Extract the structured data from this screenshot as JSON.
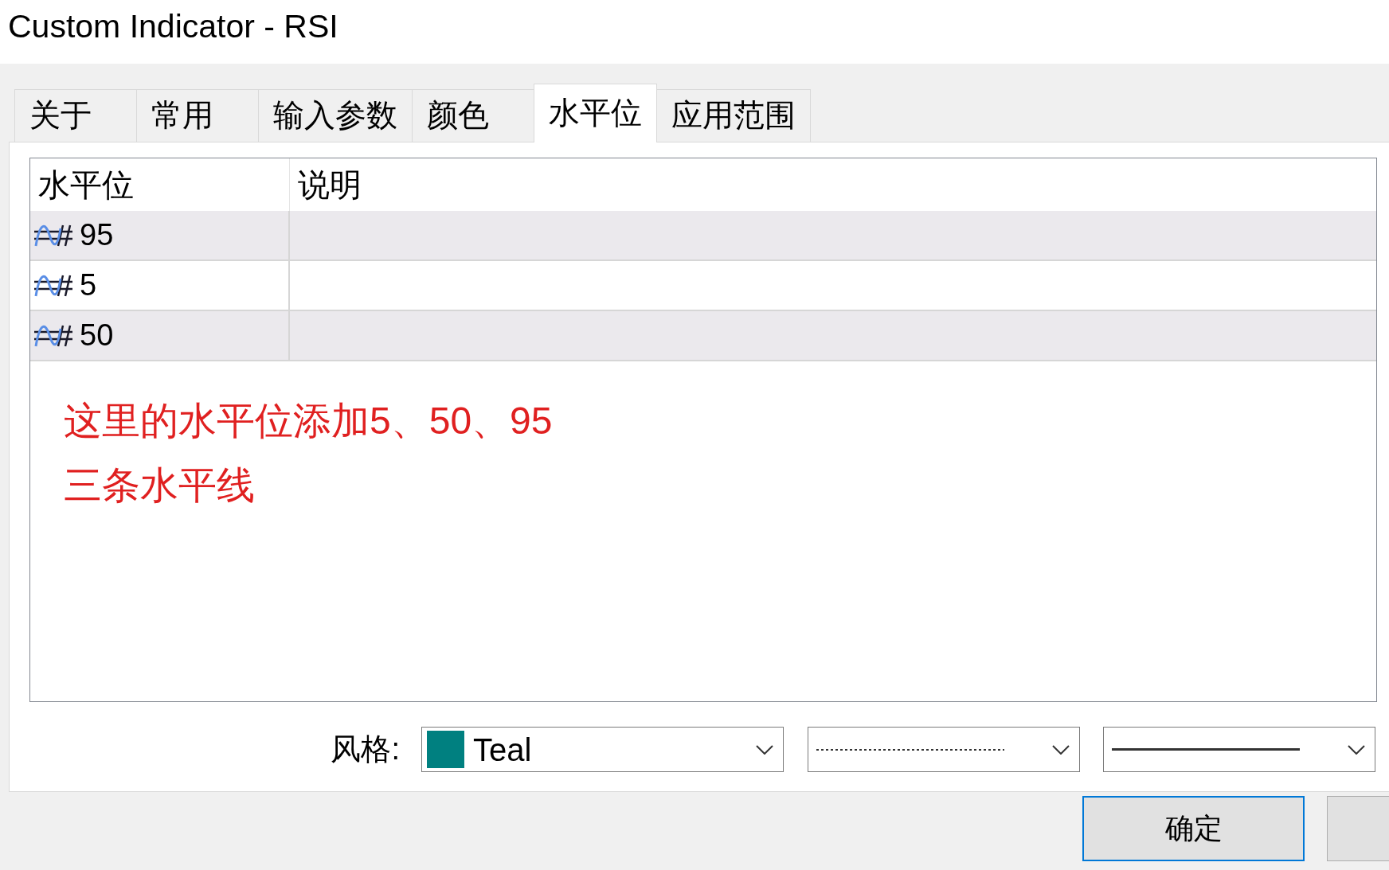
{
  "window": {
    "title": "Custom Indicator - RSI"
  },
  "tabs": [
    {
      "label": "关于",
      "selected": false
    },
    {
      "label": "常用",
      "selected": false
    },
    {
      "label": "输入参数",
      "selected": false
    },
    {
      "label": "颜色",
      "selected": false
    },
    {
      "label": "水平位",
      "selected": true
    },
    {
      "label": "应用范围",
      "selected": false
    }
  ],
  "levels_table": {
    "columns": [
      "水平位",
      "说明"
    ],
    "rows": [
      {
        "value": "95"
      },
      {
        "value": "5"
      },
      {
        "value": "50"
      }
    ]
  },
  "annotation": [
    "这里的水平位添加5、50、95",
    "三条水平线"
  ],
  "style": {
    "label": "风格:",
    "dropdowns": [
      {
        "kind": "color",
        "text": "Teal",
        "color": "#008080"
      },
      {
        "kind": "dotted"
      },
      {
        "kind": "solid"
      }
    ]
  },
  "buttons": [
    {
      "label": "确定",
      "focused": true
    }
  ]
}
